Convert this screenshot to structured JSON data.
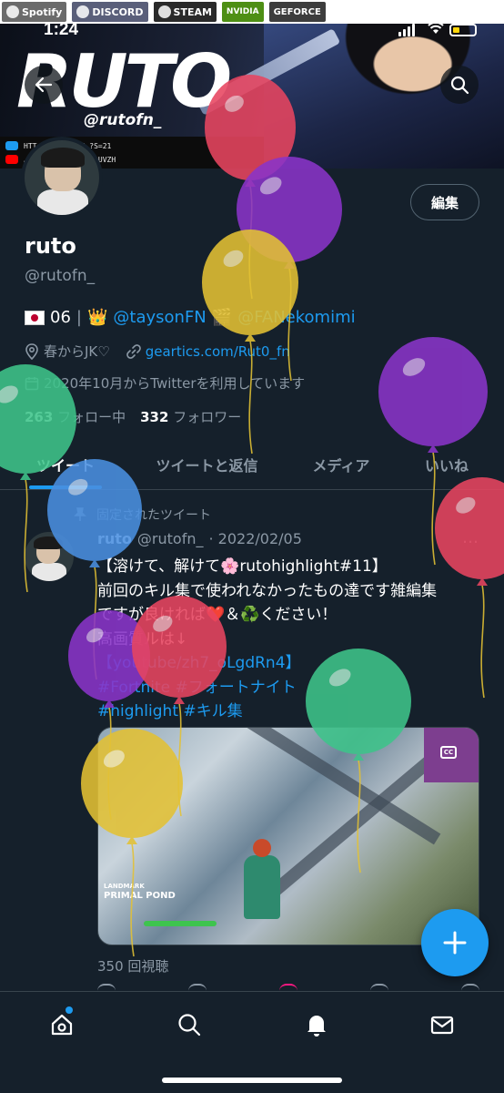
{
  "status_bar": {
    "time": "1:24"
  },
  "banner": {
    "brands": [
      "Spotify",
      "DISCORD",
      "STEAM",
      "NVIDIA",
      "GEFORCE"
    ],
    "logo_text": "RUTO",
    "handle_text": "@rutofn_",
    "link_row_1": "HTT…COM/RUTOFN_?S=21",
    "link_row_2": "…ANNEL/UC5C17UMRAUVZH"
  },
  "header": {
    "back_icon": "arrow-left-icon",
    "search_icon": "search-icon"
  },
  "profile": {
    "edit_label": "編集",
    "name": "ruto",
    "handle": "@rutofn_",
    "bio_number": "06",
    "bio_sep": "|",
    "bio_mention_1": "@taysonFN",
    "bio_mention_2": "@FANekomimi",
    "location": "春からJK♡",
    "website": "geartics.com/Rut0_fn",
    "joined": "2020年10月からTwitterを利用しています",
    "following_count": "263",
    "following_label": "フォロー中",
    "followers_count": "332",
    "followers_label": "フォロワー"
  },
  "tabs": [
    {
      "label": "ツイート",
      "active": true
    },
    {
      "label": "ツイートと返信",
      "active": false
    },
    {
      "label": "メディア",
      "active": false
    },
    {
      "label": "いいね",
      "active": false
    }
  ],
  "tweet": {
    "pinned_label": "固定されたツイート",
    "author_name": "ruto",
    "author_handle": "@rutofn_",
    "date": "· 2022/02/05",
    "more": "…",
    "lines": [
      "【溶けて、解けて🌸rutohighlight#11】",
      "前回のキル集で使われなかったもの達です雑編集",
      "ですが良ければ❤️＆♻️ください！",
      "高画質ルは↓",
      "【youtube/zh7_oLgdRn4】",
      " #Fortnite  #フォートナイト",
      "#highlight  #キル集"
    ],
    "media_overlay_small": "LANDMARK",
    "media_overlay_big": "PRIMAL POND",
    "views": "350 回視聴"
  },
  "colors": {
    "background": "#15202b",
    "accent": "#1d9bf0",
    "muted": "#8b98a5",
    "like": "#f91880"
  },
  "nav": {
    "items": [
      "home-icon",
      "search-icon",
      "bell-icon",
      "mail-icon"
    ]
  },
  "balloon_colors": [
    "#e84560",
    "#8a34c9",
    "#e3c134",
    "#8a34c9",
    "#3ec48a",
    "#4a8fe0",
    "#e84560",
    "#8a34c9",
    "#e84560",
    "#3ec48a",
    "#e3c134"
  ]
}
